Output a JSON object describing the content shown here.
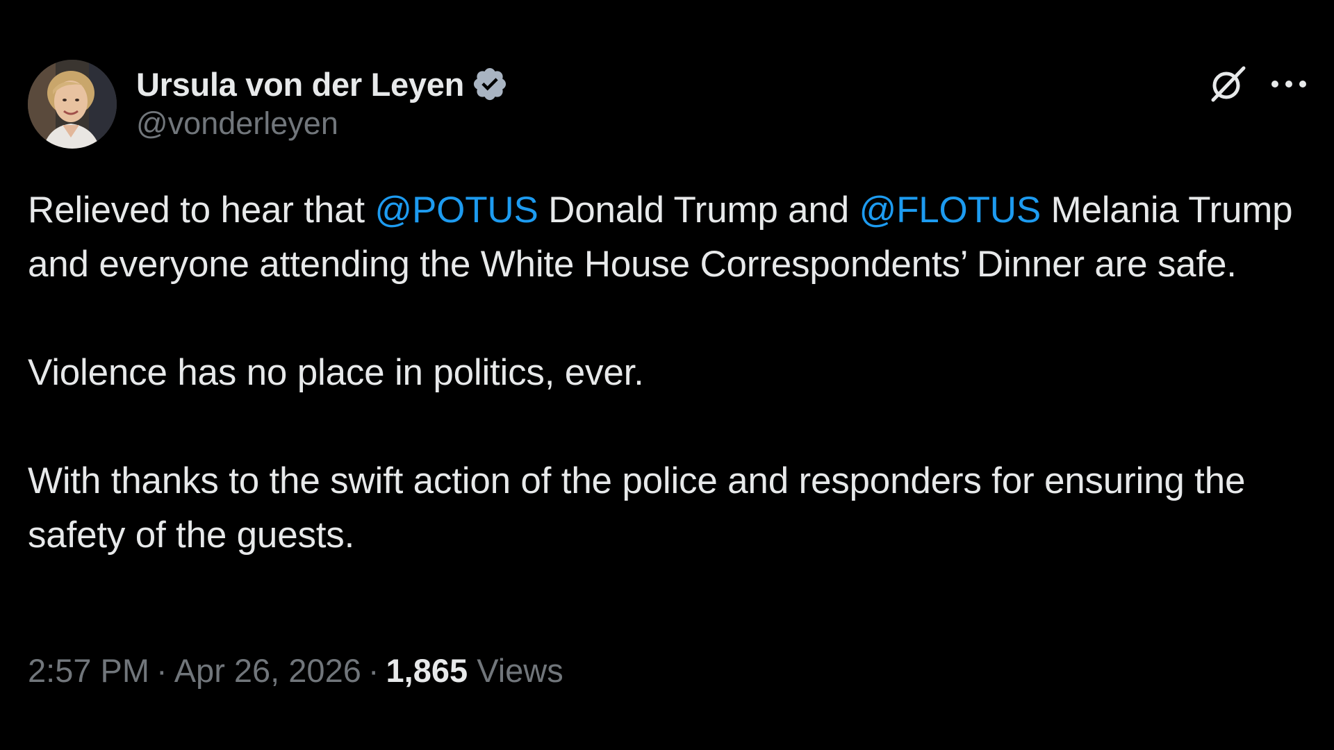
{
  "author": {
    "display_name": "Ursula von der Leyen",
    "handle": "@vonderleyen",
    "verified": true,
    "avatar_icon": "profile-photo"
  },
  "header_actions": {
    "grok_icon": "grok-icon",
    "more_icon": "more-options-icon"
  },
  "tweet": {
    "paragraphs": [
      [
        {
          "type": "text",
          "value": "Relieved to hear that "
        },
        {
          "type": "mention",
          "value": "@POTUS"
        },
        {
          "type": "text",
          "value": " Donald Trump and "
        },
        {
          "type": "mention",
          "value": "@FLOTUS"
        },
        {
          "type": "text",
          "value": " Melania Trump and everyone attending the White House Correspondents’ Dinner are safe."
        }
      ],
      [
        {
          "type": "text",
          "value": "Violence has no place in politics, ever."
        }
      ],
      [
        {
          "type": "text",
          "value": "With thanks to the swift action of the police and responders for ensuring the safety of the guests."
        }
      ]
    ]
  },
  "meta": {
    "time": "2:57 PM",
    "separator": "·",
    "date": "Apr 26, 2026",
    "views_count": "1,865",
    "views_label": "Views"
  },
  "colors": {
    "background": "#000000",
    "text": "#e7e9ea",
    "secondary": "#71767b",
    "mention": "#1d9bf0",
    "verified_badge": "#a9b4c2"
  }
}
